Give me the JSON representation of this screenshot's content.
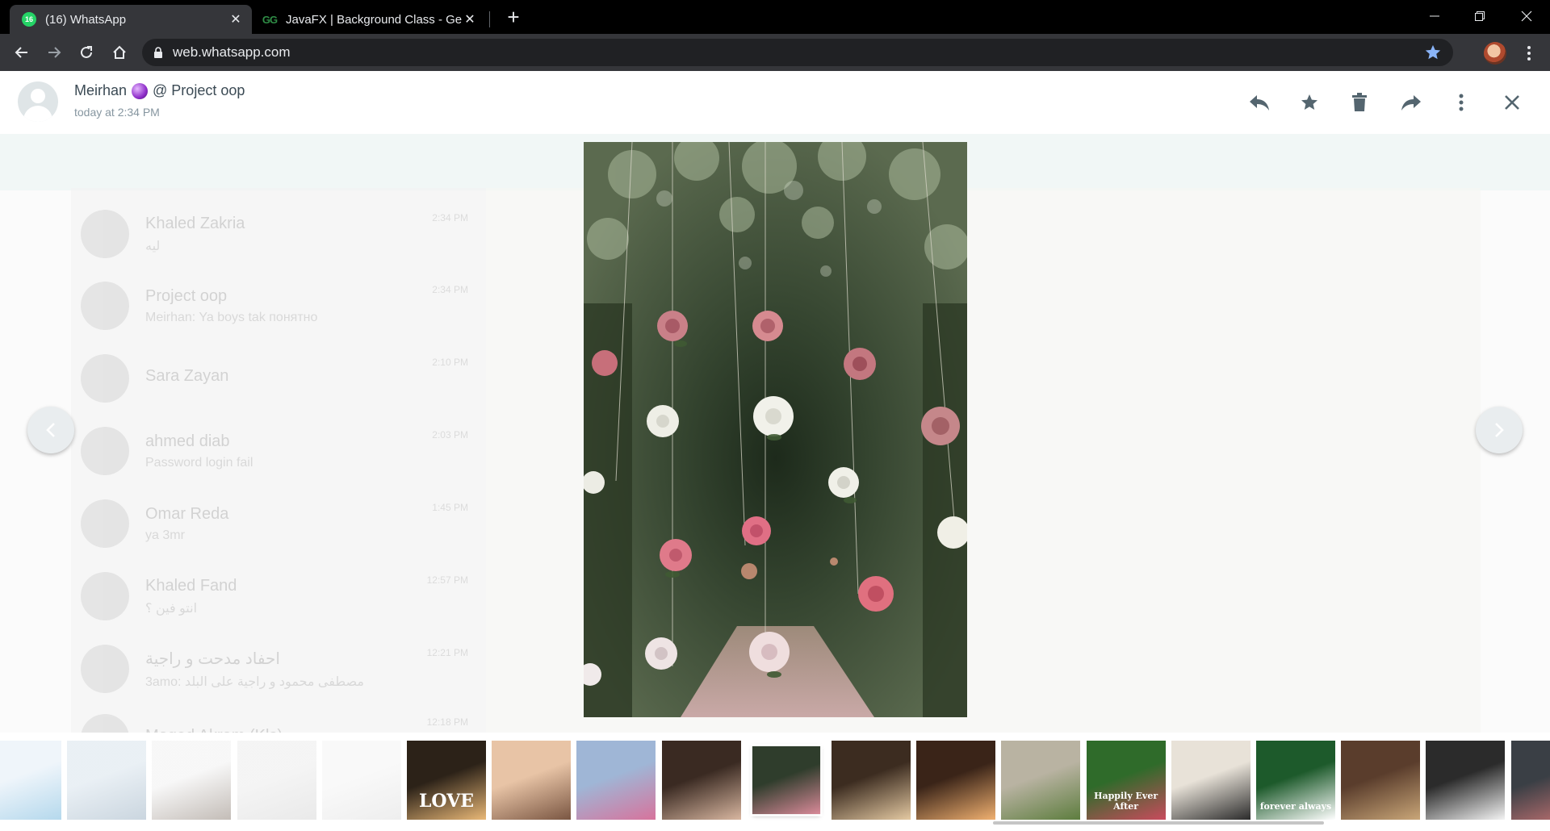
{
  "browser": {
    "tabs": [
      {
        "title": "(16) WhatsApp",
        "favicon": "whatsapp-icon",
        "badge": "16",
        "active": true
      },
      {
        "title": "JavaFX | Background Class - Geek",
        "favicon": "geeksforgeeks-icon",
        "favicon_text": "GG",
        "active": false
      }
    ],
    "url": "web.whatsapp.com",
    "accent_color": "#8ab4f8"
  },
  "viewer": {
    "sender_name": "Meirhan",
    "chat_name": "@ Project oop",
    "timestamp": "today at 2:34 PM",
    "image_description_icon": "hanging-roses-photo",
    "actions": [
      "reply-icon",
      "star-icon",
      "delete-icon",
      "forward-icon",
      "menu-icon",
      "close-icon"
    ]
  },
  "background_chats": [
    {
      "name": "Khaled Zakria",
      "last": "ليه",
      "time": "2:34 PM"
    },
    {
      "name": "Project oop",
      "last": "Meirhan: Ya boys tak понятно",
      "time": "2:34 PM"
    },
    {
      "name": "Sara Zayan",
      "last": "",
      "time": "2:10 PM"
    },
    {
      "name": "ahmed diab",
      "last": "Password login fail",
      "time": "2:03 PM"
    },
    {
      "name": "Omar Reda",
      "last": "ya 3mr",
      "time": "1:45 PM"
    },
    {
      "name": "Khaled Fand",
      "last": "انتو فين ؟",
      "time": "12:57 PM"
    },
    {
      "name": "احفاد مدحت و راجية",
      "last": "3amo: مصطفى محمود و راجية على البلد",
      "time": "12:21 PM"
    },
    {
      "name": "Maged Akram (Kls)",
      "last": "",
      "time": "12:18 PM"
    }
  ],
  "thumbnails": [
    {
      "name": "thumb-blue-boxes",
      "colors": [
        "#dbe9f5",
        "#5aa9d6"
      ]
    },
    {
      "name": "thumb-glass-building",
      "colors": [
        "#cfdde8",
        "#8aa3b8"
      ]
    },
    {
      "name": "thumb-people-sitting",
      "colors": [
        "#eeeeee",
        "#7a6b5f"
      ]
    },
    {
      "name": "thumb-gray-screen",
      "colors": [
        "#e8e8e8",
        "#cfcfcf"
      ]
    },
    {
      "name": "thumb-web-screenshot",
      "colors": [
        "#f2f2f2",
        "#d9d9d9"
      ]
    },
    {
      "name": "thumb-love-sign",
      "colors": [
        "#2c2218",
        "#e9b877"
      ],
      "label": "LOVE"
    },
    {
      "name": "thumb-sunset-tables",
      "colors": [
        "#e8c4a6",
        "#7a5642"
      ]
    },
    {
      "name": "thumb-pink-arch",
      "colors": [
        "#9fb6d6",
        "#d7739c"
      ]
    },
    {
      "name": "thumb-pampas-flowers",
      "colors": [
        "#3a2a22",
        "#d8b6a0"
      ]
    },
    {
      "name": "thumb-hanging-roses",
      "colors": [
        "#2f3d2c",
        "#d98a99"
      ],
      "selected": true
    },
    {
      "name": "thumb-reception-hall",
      "colors": [
        "#3c2c20",
        "#e4c9a2"
      ]
    },
    {
      "name": "thumb-candle-chandelier",
      "colors": [
        "#3a2418",
        "#f0b070"
      ]
    },
    {
      "name": "thumb-round-arch",
      "colors": [
        "#b9b3a2",
        "#5d7d3e"
      ]
    },
    {
      "name": "thumb-greenery-wall",
      "colors": [
        "#2f6b2a",
        "#c94b5d"
      ],
      "label": "Happily Ever After"
    },
    {
      "name": "thumb-lantern-table",
      "colors": [
        "#e8e2d8",
        "#2b2b2b"
      ]
    },
    {
      "name": "thumb-forever-always-sign",
      "colors": [
        "#1d5a2b",
        "#ffffff"
      ],
      "label": "forever always"
    },
    {
      "name": "thumb-invitation-card",
      "colors": [
        "#5a3d2c",
        "#c9a678"
      ]
    },
    {
      "name": "thumb-daisies",
      "colors": [
        "#2b2b2b",
        "#f4f4f4"
      ]
    },
    {
      "name": "thumb-dark-floral",
      "colors": [
        "#3a3f45",
        "#c97474"
      ]
    }
  ]
}
